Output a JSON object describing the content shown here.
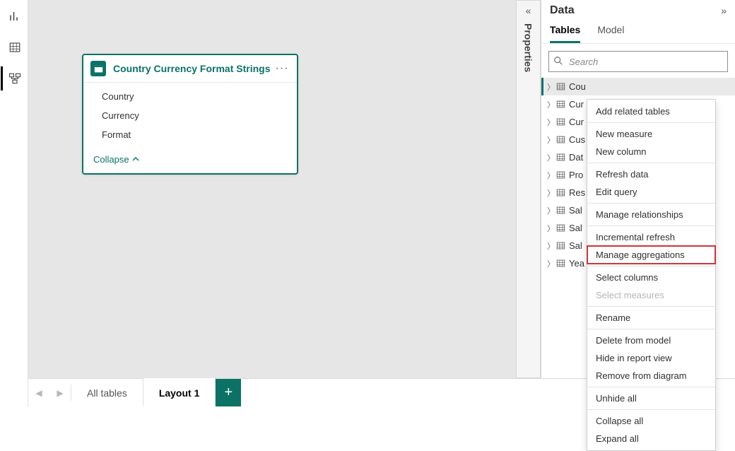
{
  "rail": {
    "views": [
      "Report",
      "Data",
      "Model"
    ]
  },
  "table_card": {
    "title": "Country Currency Format Strings",
    "fields": [
      "Country",
      "Currency",
      "Format"
    ],
    "collapse_label": "Collapse"
  },
  "bottom_tabs": {
    "all_tables": "All tables",
    "layout": "Layout 1"
  },
  "properties_label": "Properties",
  "data_panel": {
    "title": "Data",
    "tabs": {
      "tables": "Tables",
      "model": "Model"
    },
    "search_placeholder": "Search",
    "tables": [
      "Cou",
      "Cur",
      "Cur",
      "Cus",
      "Dat",
      "Pro",
      "Res",
      "Sal",
      "Sal",
      "Sal",
      "Yea"
    ]
  },
  "context_menu": {
    "groups": [
      [
        "Add related tables"
      ],
      [
        "New measure",
        "New column"
      ],
      [
        "Refresh data",
        "Edit query"
      ],
      [
        "Manage relationships"
      ],
      [
        "Incremental refresh",
        "Manage aggregations"
      ],
      [
        "Select columns",
        "Select measures"
      ],
      [
        "Rename"
      ],
      [
        "Delete from model",
        "Hide in report view",
        "Remove from diagram"
      ],
      [
        "Unhide all"
      ],
      [
        "Collapse all",
        "Expand all"
      ]
    ],
    "disabled": [
      "Select measures"
    ],
    "highlight": "Manage aggregations"
  }
}
